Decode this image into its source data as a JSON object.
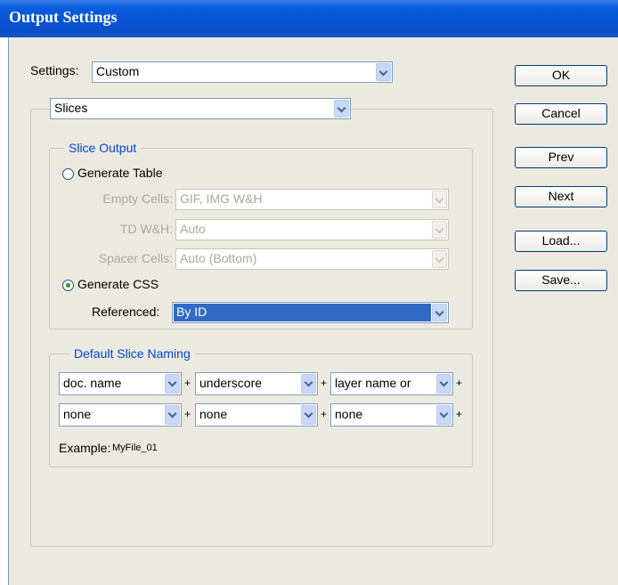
{
  "window": {
    "title": "Output Settings"
  },
  "settings": {
    "label": "Settings:",
    "value": "Custom"
  },
  "section_select": {
    "value": "Slices"
  },
  "buttons": {
    "ok": "OK",
    "cancel": "Cancel",
    "prev": "Prev",
    "next": "Next",
    "load": "Load...",
    "save": "Save..."
  },
  "slice_output": {
    "legend": "Slice Output",
    "generate_table": {
      "label": "Generate Table",
      "selected": false
    },
    "empty_cells": {
      "label": "Empty Cells:",
      "value": "GIF, IMG W&H"
    },
    "td_wh": {
      "label": "TD W&H:",
      "value": "Auto"
    },
    "spacer_cells": {
      "label": "Spacer Cells:",
      "value": "Auto (Bottom)"
    },
    "generate_css": {
      "label": "Generate CSS",
      "selected": true
    },
    "referenced": {
      "label": "Referenced:",
      "value": "By ID"
    }
  },
  "naming": {
    "legend": "Default Slice Naming",
    "row1": [
      "doc. name",
      "underscore",
      "layer name or"
    ],
    "row2": [
      "none",
      "none",
      "none"
    ],
    "plus": "+",
    "example_label": "Example:",
    "example_value": "MyFile_01"
  }
}
